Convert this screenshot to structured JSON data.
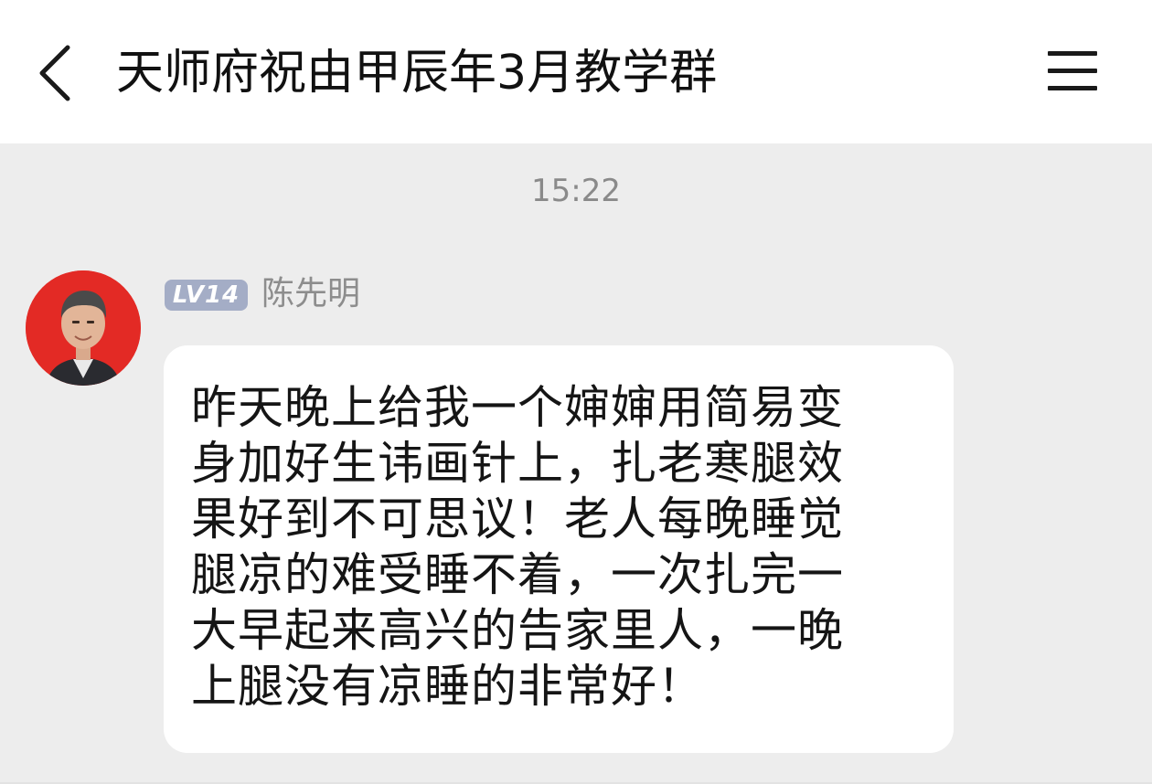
{
  "header": {
    "title": "天师府祝由甲辰年3月教学群",
    "back_icon": "chevron-left-icon",
    "menu_icon": "hamburger-menu-icon"
  },
  "chat": {
    "timestamp": "15:22",
    "message": {
      "level": "LV14",
      "sender": "陈先明",
      "avatar_color": "#e32a25",
      "lines": [
        "昨天晚上给我一个婶婶用简易变",
        "身加好生讳画针上，扎老寒腿效",
        "果好到不可思议！老人每晚睡觉",
        "腿凉的难受睡不着，一次扎完一",
        "大早起来高兴的告家里人，一晚",
        "上腿没有凉睡的非常好！"
      ]
    }
  },
  "colors": {
    "background": "#ededed",
    "header_bg": "#ffffff",
    "bubble_bg": "#ffffff",
    "badge_bg": "#a4adc6",
    "secondary_text": "#8d8d8d"
  }
}
